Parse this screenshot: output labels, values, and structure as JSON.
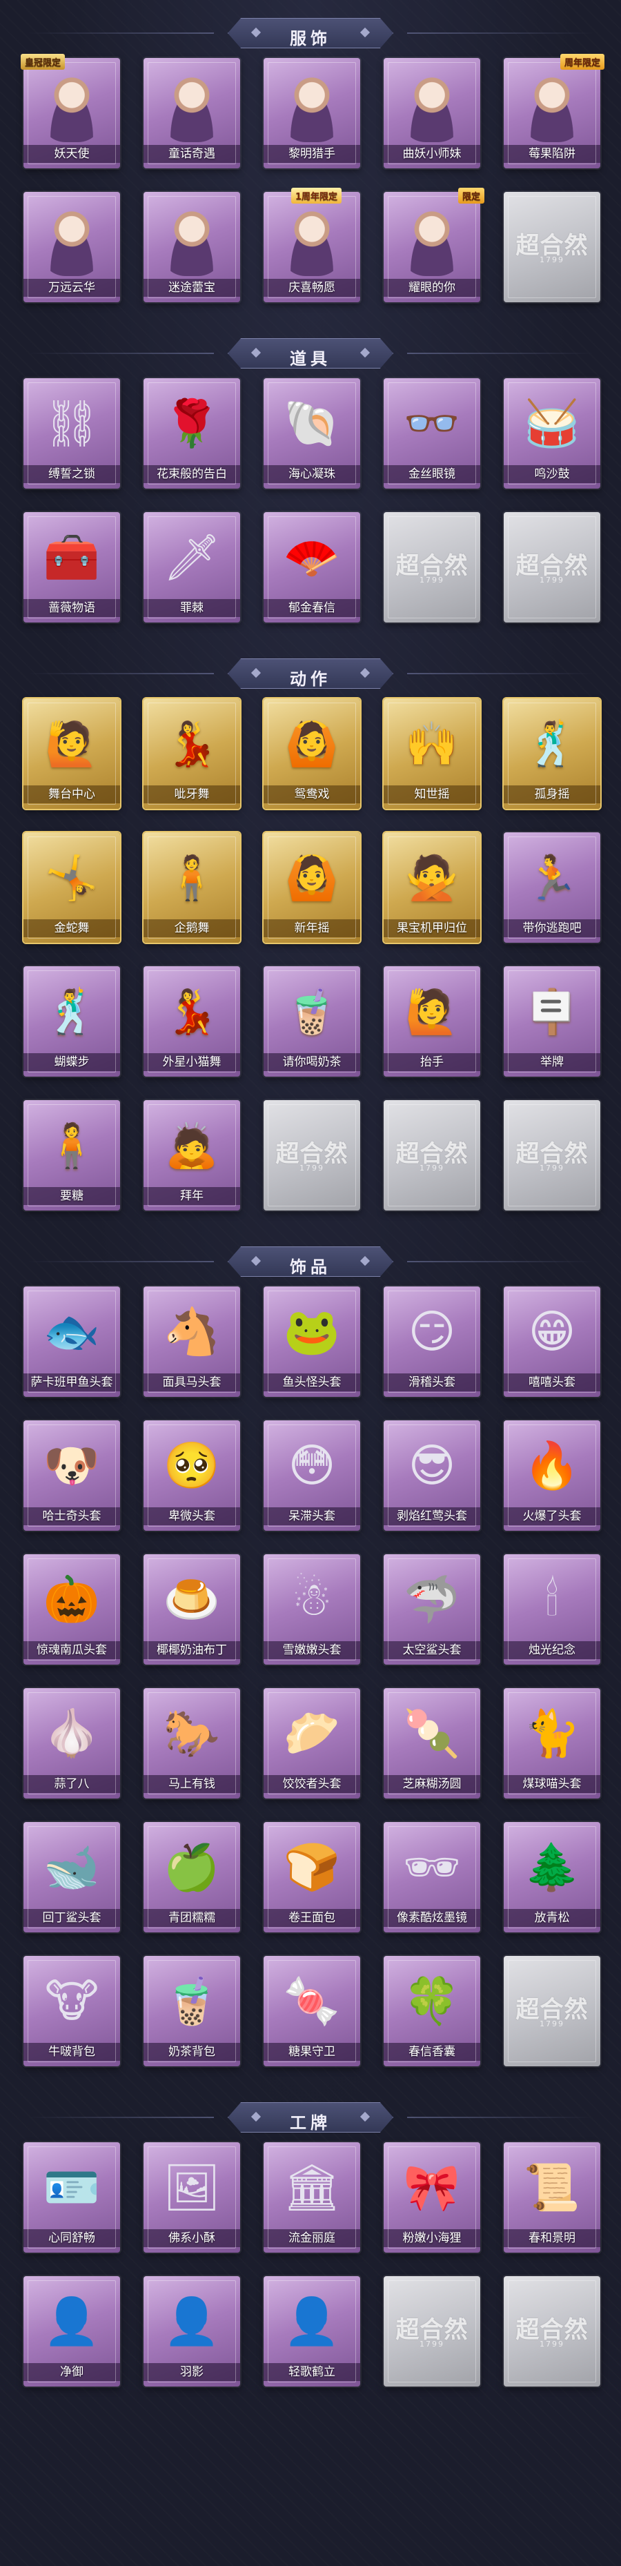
{
  "colors": {
    "background": "#1b1d2c",
    "card_purple": "#a77bbd",
    "card_gold": "#cfa950",
    "card_empty": "#bfc0c6",
    "header_plate": "#4d5276"
  },
  "empty_card": {
    "logo": "超合然",
    "sub": "1799"
  },
  "sections": [
    {
      "title": "服饰",
      "items": [
        {
          "label": "妖天使",
          "style": "purple",
          "icon": "angel-portrait-icon",
          "glyph": "",
          "badge": "皇冠限定",
          "badge_pos": "left"
        },
        {
          "label": "童话奇遇",
          "style": "purple",
          "icon": "fairytale-portrait-icon",
          "glyph": "",
          "badge": "",
          "badge_pos": ""
        },
        {
          "label": "黎明猎手",
          "style": "purple",
          "icon": "hunter-portrait-icon",
          "glyph": "",
          "badge": "",
          "badge_pos": ""
        },
        {
          "label": "曲妖小师妹",
          "style": "purple",
          "icon": "masked-portrait-icon",
          "glyph": "",
          "badge": "",
          "badge_pos": ""
        },
        {
          "label": "莓果陷阱",
          "style": "purple",
          "icon": "berry-portrait-icon",
          "glyph": "",
          "badge": "周年限定",
          "badge_pos": "right"
        },
        {
          "label": "万远云华",
          "style": "purple",
          "icon": "cloud-portrait-icon",
          "glyph": "",
          "badge": "",
          "badge_pos": ""
        },
        {
          "label": "迷途蕾宝",
          "style": "purple",
          "icon": "lost-portrait-icon",
          "glyph": "",
          "badge": "",
          "badge_pos": ""
        },
        {
          "label": "庆喜畅愿",
          "style": "purple",
          "icon": "celebration-portrait-icon",
          "glyph": "",
          "badge": "1周年限定",
          "badge_pos": "mid"
        },
        {
          "label": "耀眼的你",
          "style": "purple",
          "icon": "dazzling-portrait-icon",
          "glyph": "",
          "badge": "限定",
          "badge_pos": "right"
        },
        {
          "label": "",
          "style": "empty",
          "icon": "empty-slot-icon",
          "glyph": "",
          "badge": "",
          "badge_pos": ""
        }
      ]
    },
    {
      "title": "道具",
      "items": [
        {
          "label": "缚誓之锁",
          "style": "purple",
          "icon": "chain-lock-icon",
          "glyph": "⛓",
          "badge": "",
          "badge_pos": ""
        },
        {
          "label": "花束般的告白",
          "style": "purple",
          "icon": "rose-icon",
          "glyph": "🌹",
          "badge": "",
          "badge_pos": ""
        },
        {
          "label": "海心凝珠",
          "style": "purple",
          "icon": "pearl-shell-icon",
          "glyph": "🐚",
          "badge": "",
          "badge_pos": ""
        },
        {
          "label": "金丝眼镜",
          "style": "purple",
          "icon": "glasses-icon",
          "glyph": "👓",
          "badge": "",
          "badge_pos": ""
        },
        {
          "label": "鸣沙鼓",
          "style": "purple",
          "icon": "drum-icon",
          "glyph": "🥁",
          "badge": "",
          "badge_pos": ""
        },
        {
          "label": "蔷薇物语",
          "style": "purple",
          "icon": "medkit-icon",
          "glyph": "🧰",
          "badge": "",
          "badge_pos": ""
        },
        {
          "label": "罪棘",
          "style": "purple",
          "icon": "thorn-staff-icon",
          "glyph": "🗡",
          "badge": "",
          "badge_pos": ""
        },
        {
          "label": "郁金春信",
          "style": "purple",
          "icon": "fan-icon",
          "glyph": "🪭",
          "badge": "",
          "badge_pos": ""
        },
        {
          "label": "",
          "style": "empty",
          "icon": "empty-slot-icon",
          "glyph": "",
          "badge": "",
          "badge_pos": ""
        },
        {
          "label": "",
          "style": "empty",
          "icon": "empty-slot-icon",
          "glyph": "",
          "badge": "",
          "badge_pos": ""
        }
      ]
    },
    {
      "title": "动作",
      "items": [
        {
          "label": "舞台中心",
          "style": "gold",
          "icon": "pose-icon",
          "glyph": "🙋",
          "badge": "",
          "badge_pos": ""
        },
        {
          "label": "呲牙舞",
          "style": "gold",
          "icon": "pose-icon",
          "glyph": "💃",
          "badge": "",
          "badge_pos": ""
        },
        {
          "label": "鸳鸯戏",
          "style": "gold",
          "icon": "pose-icon",
          "glyph": "🙆",
          "badge": "",
          "badge_pos": ""
        },
        {
          "label": "知世摇",
          "style": "gold",
          "icon": "pose-icon",
          "glyph": "🙌",
          "badge": "",
          "badge_pos": ""
        },
        {
          "label": "孤身摇",
          "style": "gold",
          "icon": "pose-icon",
          "glyph": "🕺",
          "badge": "",
          "badge_pos": ""
        },
        {
          "label": "金蛇舞",
          "style": "gold",
          "icon": "pose-icon",
          "glyph": "🤸",
          "badge": "",
          "badge_pos": ""
        },
        {
          "label": "企鹅舞",
          "style": "gold",
          "icon": "pose-icon",
          "glyph": "🧍",
          "badge": "",
          "badge_pos": ""
        },
        {
          "label": "新年摇",
          "style": "gold",
          "icon": "pose-icon",
          "glyph": "🙆",
          "badge": "",
          "badge_pos": ""
        },
        {
          "label": "果宝机甲归位",
          "style": "gold",
          "icon": "pose-icon",
          "glyph": "🙅",
          "badge": "",
          "badge_pos": ""
        },
        {
          "label": "带你逃跑吧",
          "style": "purple",
          "icon": "pose-icon",
          "glyph": "🏃",
          "badge": "",
          "badge_pos": ""
        },
        {
          "label": "蝴蝶步",
          "style": "purple",
          "icon": "pose-icon",
          "glyph": "🕺",
          "badge": "",
          "badge_pos": ""
        },
        {
          "label": "外星小猫舞",
          "style": "purple",
          "icon": "pose-icon",
          "glyph": "💃",
          "badge": "",
          "badge_pos": ""
        },
        {
          "label": "请你喝奶茶",
          "style": "purple",
          "icon": "pose-icon",
          "glyph": "🧋",
          "badge": "",
          "badge_pos": ""
        },
        {
          "label": "抬手",
          "style": "purple",
          "icon": "pose-icon",
          "glyph": "🙋",
          "badge": "",
          "badge_pos": ""
        },
        {
          "label": "举牌",
          "style": "purple",
          "icon": "pose-icon",
          "glyph": "🪧",
          "badge": "",
          "badge_pos": ""
        },
        {
          "label": "要糖",
          "style": "purple",
          "icon": "pose-icon",
          "glyph": "🧍",
          "badge": "",
          "badge_pos": ""
        },
        {
          "label": "拜年",
          "style": "purple",
          "icon": "pose-icon",
          "glyph": "🙇",
          "badge": "",
          "badge_pos": ""
        },
        {
          "label": "",
          "style": "empty",
          "icon": "empty-slot-icon",
          "glyph": "",
          "badge": "",
          "badge_pos": ""
        },
        {
          "label": "",
          "style": "empty",
          "icon": "empty-slot-icon",
          "glyph": "",
          "badge": "",
          "badge_pos": ""
        },
        {
          "label": "",
          "style": "empty",
          "icon": "empty-slot-icon",
          "glyph": "",
          "badge": "",
          "badge_pos": ""
        }
      ]
    },
    {
      "title": "饰品",
      "items": [
        {
          "label": "萨卡班甲鱼头套",
          "style": "purple",
          "icon": "fish-head-icon",
          "glyph": "🐟",
          "badge": "",
          "badge_pos": ""
        },
        {
          "label": "面具马头套",
          "style": "purple",
          "icon": "horse-head-icon",
          "glyph": "🐴",
          "badge": "",
          "badge_pos": ""
        },
        {
          "label": "鱼头怪头套",
          "style": "purple",
          "icon": "fishman-head-icon",
          "glyph": "🐸",
          "badge": "",
          "badge_pos": ""
        },
        {
          "label": "滑稽头套",
          "style": "purple",
          "icon": "smirk-face-icon",
          "glyph": "😏",
          "badge": "",
          "badge_pos": ""
        },
        {
          "label": "嘻嘻头套",
          "style": "purple",
          "icon": "grin-face-icon",
          "glyph": "😁",
          "badge": "",
          "badge_pos": ""
        },
        {
          "label": "哈士奇头套",
          "style": "purple",
          "icon": "husky-head-icon",
          "glyph": "🐶",
          "badge": "",
          "badge_pos": ""
        },
        {
          "label": "卑微头套",
          "style": "purple",
          "icon": "humble-face-icon",
          "glyph": "🥺",
          "badge": "",
          "badge_pos": ""
        },
        {
          "label": "呆滞头套",
          "style": "purple",
          "icon": "dazed-face-icon",
          "glyph": "😳",
          "badge": "",
          "badge_pos": ""
        },
        {
          "label": "剥焰红莺头套",
          "style": "purple",
          "icon": "cool-bird-icon",
          "glyph": "😎",
          "badge": "",
          "badge_pos": ""
        },
        {
          "label": "火爆了头套",
          "style": "purple",
          "icon": "fire-face-icon",
          "glyph": "🔥",
          "badge": "",
          "badge_pos": ""
        },
        {
          "label": "惊魂南瓜头套",
          "style": "purple",
          "icon": "pumpkin-icon",
          "glyph": "🎃",
          "badge": "",
          "badge_pos": ""
        },
        {
          "label": "椰椰奶油布丁",
          "style": "purple",
          "icon": "pudding-icon",
          "glyph": "🍮",
          "badge": "",
          "badge_pos": ""
        },
        {
          "label": "雪嫩嫩头套",
          "style": "purple",
          "icon": "snowman-icon",
          "glyph": "☃",
          "badge": "",
          "badge_pos": ""
        },
        {
          "label": "太空鲨头套",
          "style": "purple",
          "icon": "space-shark-icon",
          "glyph": "🦈",
          "badge": "",
          "badge_pos": ""
        },
        {
          "label": "烛光纪念",
          "style": "purple",
          "icon": "candle-icon",
          "glyph": "🕯",
          "badge": "",
          "badge_pos": ""
        },
        {
          "label": "蒜了八",
          "style": "purple",
          "icon": "garlic-icon",
          "glyph": "🧄",
          "badge": "",
          "badge_pos": ""
        },
        {
          "label": "马上有钱",
          "style": "purple",
          "icon": "lucky-horse-icon",
          "glyph": "🐎",
          "badge": "",
          "badge_pos": ""
        },
        {
          "label": "饺饺者头套",
          "style": "purple",
          "icon": "dumpling-icon",
          "glyph": "🥟",
          "badge": "",
          "badge_pos": ""
        },
        {
          "label": "芝麻糊汤圆",
          "style": "purple",
          "icon": "tangyuan-icon",
          "glyph": "🍡",
          "badge": "",
          "badge_pos": ""
        },
        {
          "label": "煤球喵头套",
          "style": "purple",
          "icon": "black-cat-icon",
          "glyph": "🐈",
          "badge": "",
          "badge_pos": ""
        },
        {
          "label": "回丁鲨头套",
          "style": "purple",
          "icon": "shark-head-icon",
          "glyph": "🐋",
          "badge": "",
          "badge_pos": ""
        },
        {
          "label": "青团糯糯",
          "style": "purple",
          "icon": "qingtuan-icon",
          "glyph": "🍏",
          "badge": "",
          "badge_pos": ""
        },
        {
          "label": "卷王面包",
          "style": "purple",
          "icon": "bread-icon",
          "glyph": "🍞",
          "badge": "",
          "badge_pos": ""
        },
        {
          "label": "像素酷炫墨镜",
          "style": "purple",
          "icon": "pixel-glasses-icon",
          "glyph": "🕶",
          "badge": "",
          "badge_pos": ""
        },
        {
          "label": "放青松",
          "style": "purple",
          "icon": "bonsai-icon",
          "glyph": "🌲",
          "badge": "",
          "badge_pos": ""
        },
        {
          "label": "牛啵背包",
          "style": "purple",
          "icon": "cow-backpack-icon",
          "glyph": "🐮",
          "badge": "",
          "badge_pos": ""
        },
        {
          "label": "奶茶背包",
          "style": "purple",
          "icon": "milktea-backpack-icon",
          "glyph": "🧋",
          "badge": "",
          "badge_pos": ""
        },
        {
          "label": "糖果守卫",
          "style": "purple",
          "icon": "candy-guard-icon",
          "glyph": "🍬",
          "badge": "",
          "badge_pos": ""
        },
        {
          "label": "春信香囊",
          "style": "purple",
          "icon": "sachet-icon",
          "glyph": "🍀",
          "badge": "",
          "badge_pos": ""
        },
        {
          "label": "",
          "style": "empty",
          "icon": "empty-slot-icon",
          "glyph": "",
          "badge": "",
          "badge_pos": ""
        }
      ]
    },
    {
      "title": "工牌",
      "items": [
        {
          "label": "心同舒畅",
          "style": "purple",
          "icon": "badge-card-icon",
          "glyph": "🪪",
          "badge": "",
          "badge_pos": ""
        },
        {
          "label": "佛系小酥",
          "style": "purple",
          "icon": "badge-card-icon",
          "glyph": "🖼",
          "badge": "",
          "badge_pos": ""
        },
        {
          "label": "流金丽庭",
          "style": "purple",
          "icon": "badge-card-icon",
          "glyph": "🏛",
          "badge": "",
          "badge_pos": ""
        },
        {
          "label": "粉嫩小海狸",
          "style": "purple",
          "icon": "badge-card-icon",
          "glyph": "🎀",
          "badge": "",
          "badge_pos": ""
        },
        {
          "label": "春和景明",
          "style": "purple",
          "icon": "badge-card-icon",
          "glyph": "📜",
          "badge": "",
          "badge_pos": ""
        },
        {
          "label": "净御",
          "style": "purple",
          "icon": "silhouette-card-icon",
          "glyph": "👤",
          "badge": "",
          "badge_pos": ""
        },
        {
          "label": "羽影",
          "style": "purple",
          "icon": "silhouette-card-icon",
          "glyph": "👤",
          "badge": "",
          "badge_pos": ""
        },
        {
          "label": "轻歌鹤立",
          "style": "purple",
          "icon": "silhouette-card-icon",
          "glyph": "👤",
          "badge": "",
          "badge_pos": ""
        },
        {
          "label": "",
          "style": "empty",
          "icon": "empty-slot-icon",
          "glyph": "",
          "badge": "",
          "badge_pos": ""
        },
        {
          "label": "",
          "style": "empty",
          "icon": "empty-slot-icon",
          "glyph": "",
          "badge": "",
          "badge_pos": ""
        }
      ]
    }
  ]
}
